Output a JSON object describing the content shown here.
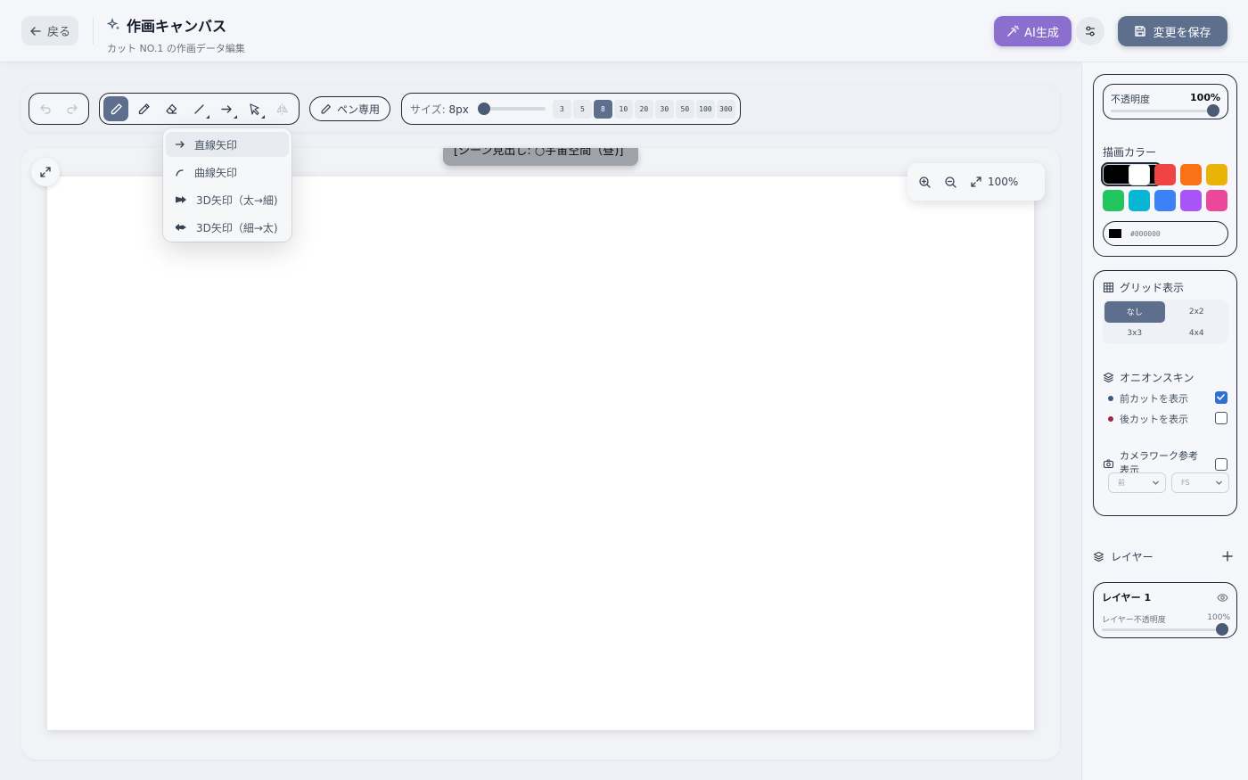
{
  "header": {
    "back_label": "戻る",
    "title": "作画キャンバス",
    "subtitle": "カット NO.1 の作画データ編集",
    "ai_label": "AI生成",
    "save_label": "変更を保存"
  },
  "toolbar": {
    "pen_only_label": "ペン専用",
    "size_label": "サイズ:",
    "size_value": "8px",
    "size_presets": [
      "3",
      "5",
      "8",
      "10",
      "20",
      "30",
      "50",
      "100",
      "300"
    ],
    "active_size": "8",
    "active_tool": "pen"
  },
  "arrow_menu": {
    "items": [
      "直線矢印",
      "曲線矢印",
      "3D矢印（太→細)",
      "3D矢印（細→太)"
    ]
  },
  "canvas": {
    "scene_label": "[シーン見出し: ○宇宙空間（昼)]",
    "zoom_value": "100%"
  },
  "color_panel": {
    "opacity_label": "不透明度",
    "opacity_value": "100%",
    "opacity_level": 1.0,
    "title": "描画カラー",
    "swatches": [
      "#000000",
      "#ffffff",
      "#ef4444",
      "#f97316",
      "#eab308",
      "#22c55e",
      "#06b6d4",
      "#3b82f6",
      "#a855f7",
      "#ec4899"
    ],
    "selected_hex": "#000000"
  },
  "grid_panel": {
    "title": "グリッド表示",
    "options": [
      "なし",
      "2x2",
      "3x3",
      "4x4"
    ],
    "active": "なし",
    "onion_title": "オニオンスキン",
    "onion_prev_label": "前カットを表示",
    "onion_prev_checked": true,
    "onion_next_label": "後カットを表示",
    "onion_next_checked": false,
    "camera_label_1": "カメラワーク参考",
    "camera_label_2": "表示",
    "camera_checked": false,
    "select_1": "前",
    "select_2": "FS"
  },
  "layers": {
    "title": "レイヤー",
    "items": [
      {
        "name": "レイヤー 1",
        "opacity_label": "レイヤー不透明度",
        "opacity_value": "100%"
      }
    ]
  },
  "colors": {
    "accent": "#5d6f8d",
    "ai": "#8b6fcf",
    "onion_prev_dot": "#3b5a80",
    "onion_next_dot": "#9b2c3f"
  }
}
